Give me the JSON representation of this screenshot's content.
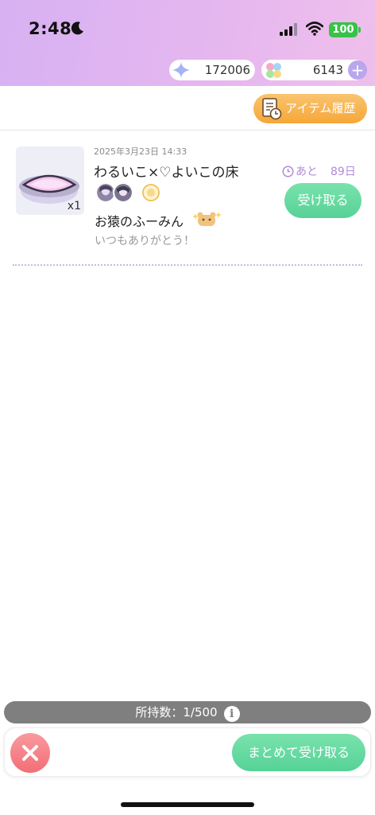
{
  "status_bar": {
    "time": "2:48",
    "battery": "100"
  },
  "currencies": {
    "sparkle": "172006",
    "clover": "6143"
  },
  "toolbar": {
    "history_label": "アイテム履歴"
  },
  "gift": {
    "date": "2025年3月23日 14:33",
    "item_name": "わるいこ×♡よいこの床",
    "quantity": "x1",
    "remain_prefix": "あと",
    "remain_days": "89日",
    "sender": "お猿のふーみん",
    "message": "いつもありがとう！",
    "receive_label": "受け取る"
  },
  "footer": {
    "count": "所持数：1/500",
    "receive_all_label": "まとめて受け取る"
  },
  "colors": {
    "header_gradient_start": "#d7b1f3",
    "header_gradient_end": "#efbfeb",
    "receive_green": "#56d297",
    "history_orange": "#f6a737",
    "close_red": "#f26e76",
    "remain_purple": "#b28ad9"
  },
  "icons": {
    "status": [
      "moon-icon",
      "signal-icon",
      "wifi-icon"
    ],
    "currencies": [
      "sparkle-icon",
      "clover-icon",
      "plus-icon"
    ],
    "misc": [
      "history-icon",
      "clock-icon",
      "info-icon",
      "close-icon",
      "bear-icon"
    ]
  }
}
